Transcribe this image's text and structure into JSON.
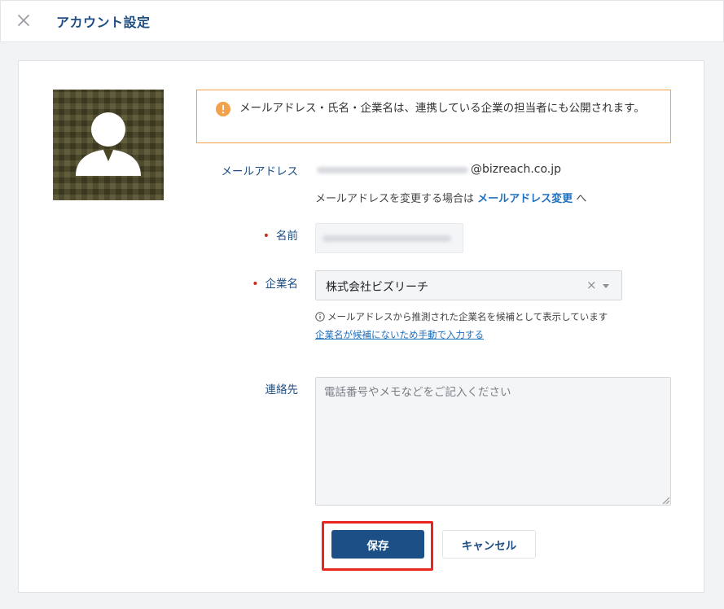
{
  "header": {
    "title": "アカウント設定",
    "close_icon": "close-icon"
  },
  "notice": {
    "icon": "warning-icon",
    "text": "メールアドレス・氏名・企業名は、連携している企業の担当者にも公開されます。",
    "color": "#f2a24a"
  },
  "form": {
    "email": {
      "label": "メールアドレス",
      "domain": "@bizreach.co.jp",
      "change_prefix": "メールアドレスを変更する場合は",
      "change_link": "メールアドレス変更",
      "change_suffix": "へ"
    },
    "name": {
      "required_mark": "•",
      "label": "名前"
    },
    "company": {
      "required_mark": "•",
      "label": "企業名",
      "selected_value": "株式会社ビズリーチ",
      "clear_glyph": "×",
      "info_text": "メールアドレスから推測された企業名を候補として表示しています",
      "manual_link": "企業名が候補にないため手動で入力する"
    },
    "contact": {
      "label": "連絡先",
      "placeholder": "電話番号やメモなどをご記入ください"
    }
  },
  "actions": {
    "save_label": "保存",
    "cancel_label": "キャンセル"
  },
  "colors": {
    "primary": "#1b4f86",
    "link": "#1f6fbf",
    "required": "#d0271c",
    "highlight": "#e8261f"
  }
}
